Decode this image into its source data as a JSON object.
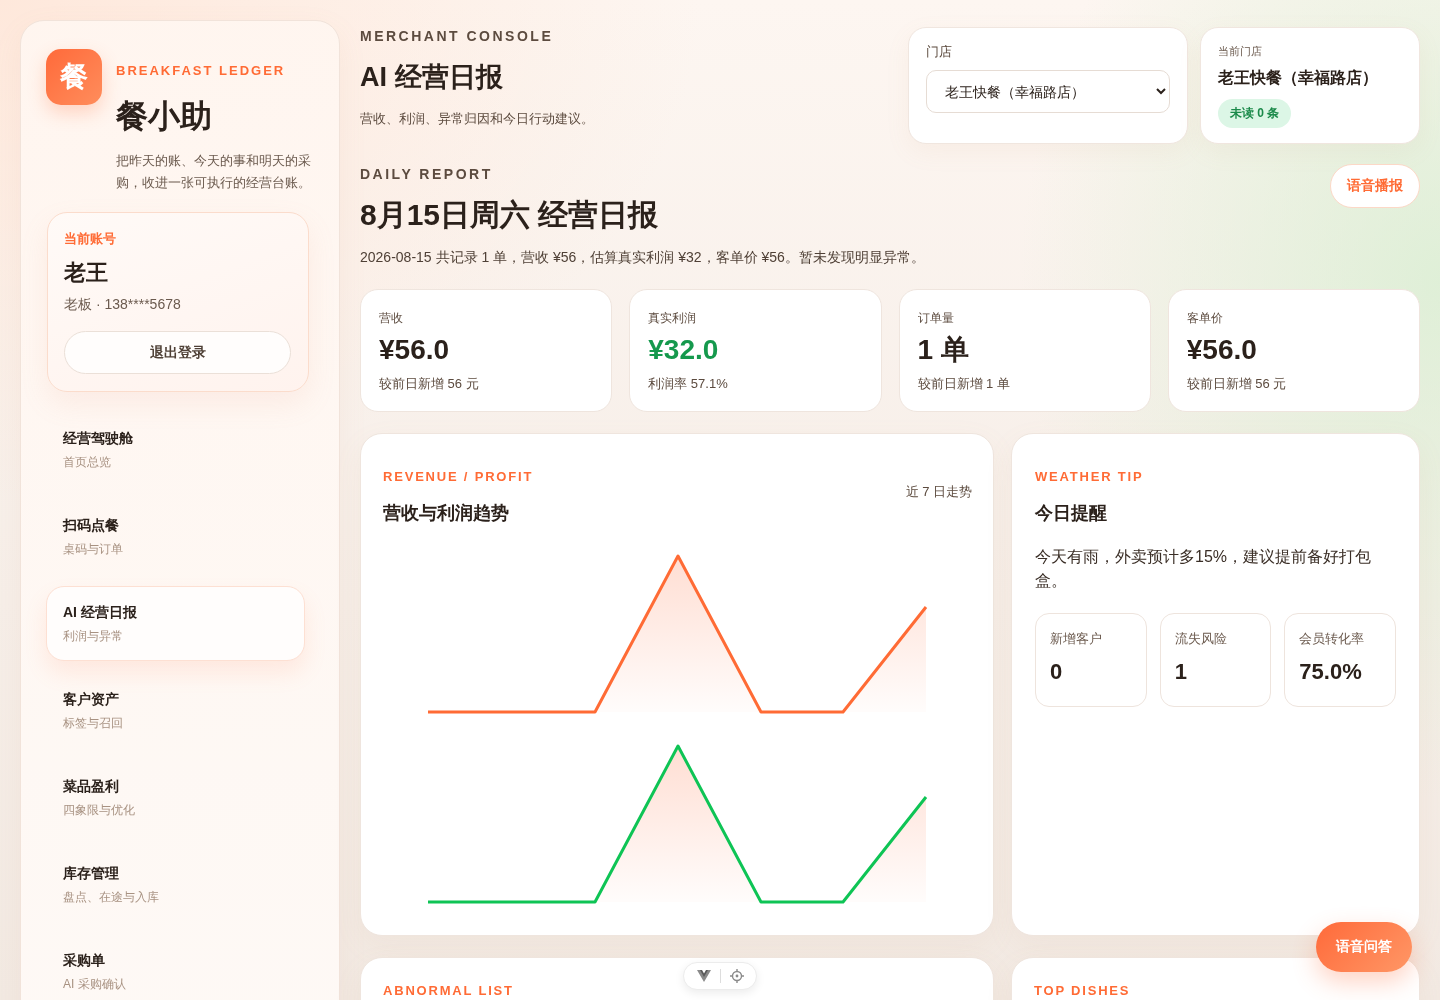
{
  "sidebar": {
    "brand": {
      "logo_char": "餐",
      "tagline": "BREAKFAST LEDGER",
      "name": "餐小助",
      "description": "把昨天的账、今天的事和明天的采购，收进一张可执行的经营台账。"
    },
    "account": {
      "label": "当前账号",
      "name": "老王",
      "role": "老板 · 138****5678",
      "logout_button": "退出登录"
    },
    "nav": [
      {
        "title": "经营驾驶舱",
        "subtitle": "首页总览",
        "selected": false
      },
      {
        "title": "扫码点餐",
        "subtitle": "桌码与订单",
        "selected": false
      },
      {
        "title": "AI 经营日报",
        "subtitle": "利润与异常",
        "selected": true
      },
      {
        "title": "客户资产",
        "subtitle": "标签与召回",
        "selected": false
      },
      {
        "title": "菜品盈利",
        "subtitle": "四象限与优化",
        "selected": false
      },
      {
        "title": "库存管理",
        "subtitle": "盘点、在途与入库",
        "selected": false
      },
      {
        "title": "采购单",
        "subtitle": "AI 采购确认",
        "selected": false
      }
    ]
  },
  "header": {
    "eyebrow": "MERCHANT CONSOLE",
    "title": "AI 经营日报",
    "subtitle": "营收、利润、异常归因和今日行动建议。"
  },
  "store_picker": {
    "label": "门店",
    "value": "老王快餐（幸福路店）"
  },
  "current_store": {
    "label": "当前门店",
    "name": "老王快餐（幸福路店）",
    "badge": "未读 0 条"
  },
  "report": {
    "eyebrow": "DAILY REPORT",
    "title": "8月15日周六 经营日报",
    "summary": "2026-08-15 共记录 1 单，营收 ¥56，估算真实利润 ¥32，客单价 ¥56。暂未发现明显异常。",
    "voice_button": "语音播报"
  },
  "metrics": [
    {
      "label": "营收",
      "value": "¥56.0",
      "note": "较前日新增 56 元",
      "kind": "plain"
    },
    {
      "label": "真实利润",
      "value": "¥32.0",
      "note": "利润率 57.1%",
      "kind": "positive"
    },
    {
      "label": "订单量",
      "value": "1 单",
      "note": "较前日新增 1 单",
      "kind": "plain"
    },
    {
      "label": "客单价",
      "value": "¥56.0",
      "note": "较前日新增 56 元",
      "kind": "plain"
    }
  ],
  "trend_card": {
    "eyebrow": "REVENUE / PROFIT",
    "title": "营收与利润趋势",
    "range": "近 7 日走势"
  },
  "weather_card": {
    "eyebrow": "WEATHER TIP",
    "title": "今日提醒",
    "message": "今天有雨，外卖预计多15%，建议提前备好打包盒。",
    "stats": [
      {
        "label": "新增客户",
        "value": "0"
      },
      {
        "label": "流失风险",
        "value": "1"
      },
      {
        "label": "会员转化率",
        "value": "75.0%"
      }
    ]
  },
  "bottom_cards": [
    {
      "eyebrow": "ABNORMAL LIST"
    },
    {
      "eyebrow": "TOP DISHES"
    }
  ],
  "voice_qa_button": "语音问答"
}
